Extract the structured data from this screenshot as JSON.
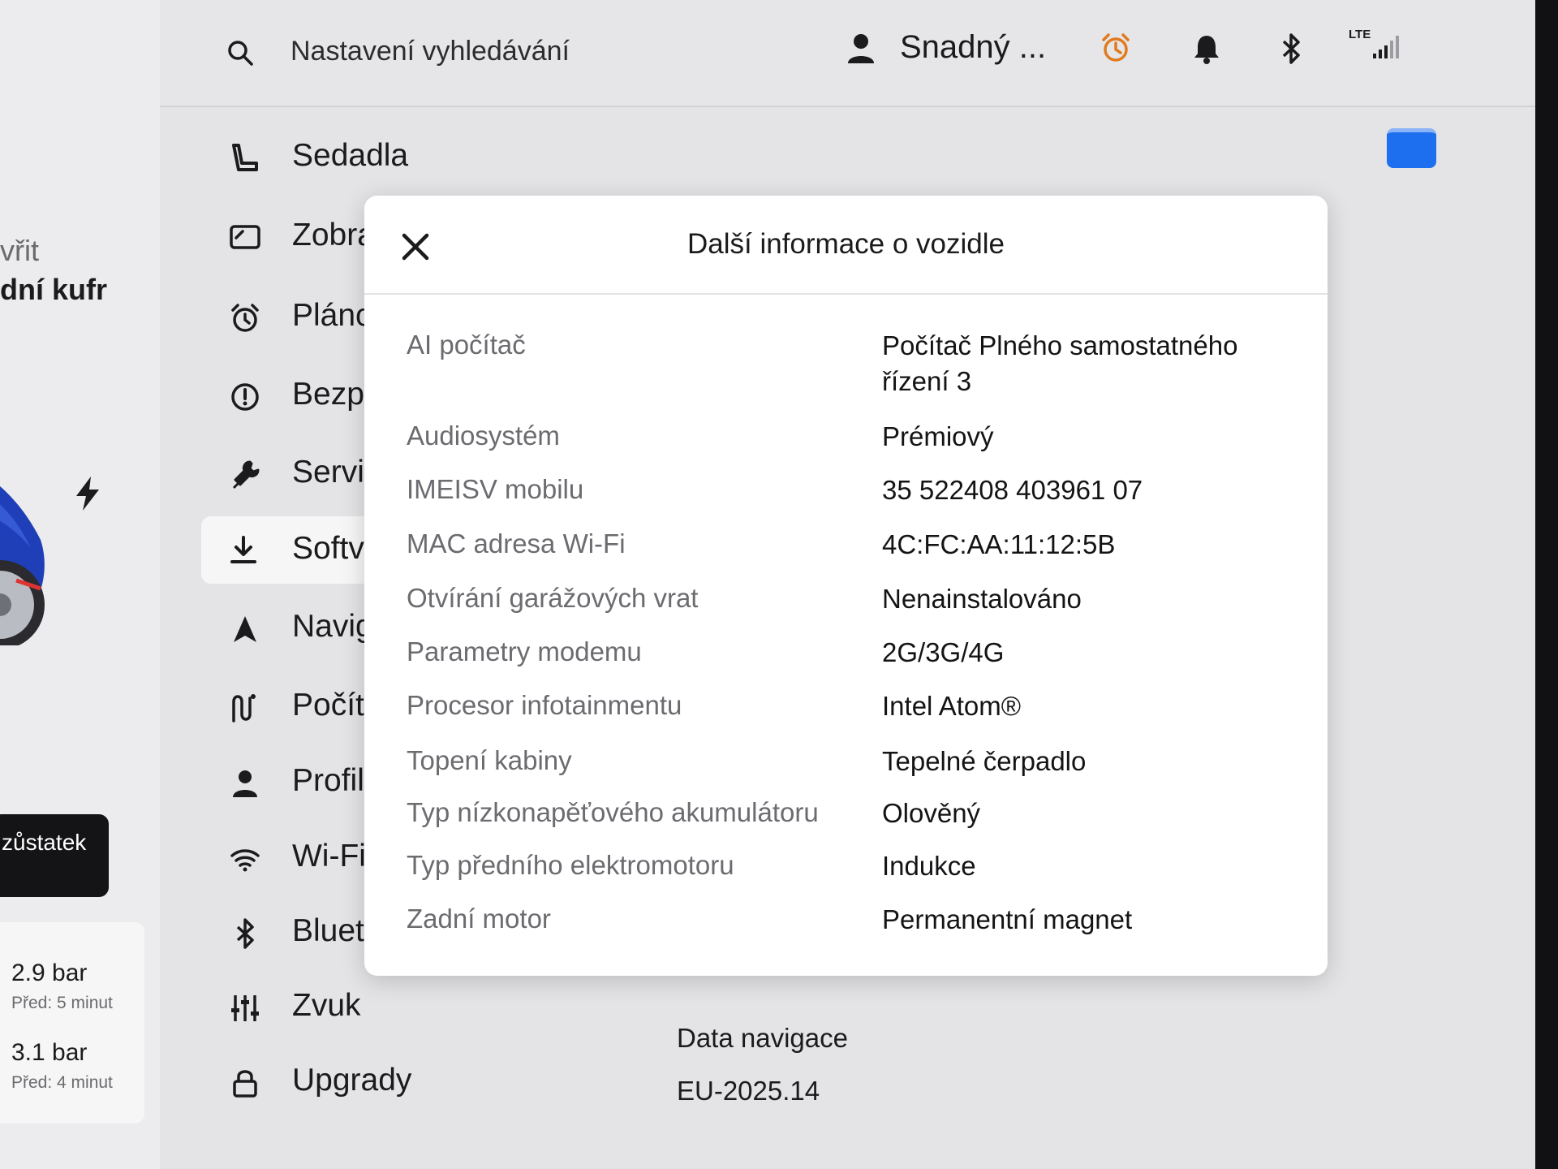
{
  "left_panel": {
    "open_text": "vřit",
    "trunk_text": "dní kufr",
    "remaining_label": "zůstatek",
    "tires": [
      {
        "value": "2.9 bar",
        "time": "Před: 5 minut"
      },
      {
        "value": "3.1 bar",
        "time": "Před: 4 minut"
      }
    ]
  },
  "topbar": {
    "search_placeholder": "Nastavení vyhledávání",
    "profile_name": "Snadný ...",
    "network_label": "LTE",
    "alarm_color": "#e07a1f"
  },
  "menu": [
    {
      "label": "Sedadla",
      "icon": "seat-icon",
      "active": false
    },
    {
      "label": "Zobra",
      "icon": "display-icon",
      "active": false
    },
    {
      "label": "Pláno",
      "icon": "alarm-clock-icon",
      "active": false
    },
    {
      "label": "Bezp",
      "icon": "exclamation-circle-icon",
      "active": false
    },
    {
      "label": "Servi",
      "icon": "wrench-icon",
      "active": false
    },
    {
      "label": "Softv",
      "icon": "download-icon",
      "active": true
    },
    {
      "label": "Navig",
      "icon": "navigation-arrow-icon",
      "active": false
    },
    {
      "label": "Počít",
      "icon": "route-icon",
      "active": false
    },
    {
      "label": "Profil",
      "icon": "person-icon",
      "active": false
    },
    {
      "label": "Wi-Fi",
      "icon": "wifi-icon",
      "active": false
    },
    {
      "label": "Bluet",
      "icon": "bluetooth-icon",
      "active": false
    },
    {
      "label": "Zvuk",
      "icon": "sliders-icon",
      "active": false
    },
    {
      "label": "Upgrady",
      "icon": "lock-icon",
      "active": false
    }
  ],
  "nav_data": {
    "title": "Data navigace",
    "value": "EU-2025.14"
  },
  "modal": {
    "title": "Další informace o vozidle",
    "rows": [
      {
        "label": "AI počítač",
        "value": "Počítač Plného samostatného řízení 3"
      },
      {
        "label": "Audiosystém",
        "value": "Prémiový"
      },
      {
        "label": "IMEISV mobilu",
        "value": "35 522408 403961 07"
      },
      {
        "label": "MAC adresa Wi-Fi",
        "value": "4C:FC:AA:11:12:5B"
      },
      {
        "label": "Otvírání garážových vrat",
        "value": "Nenainstalováno"
      },
      {
        "label": "Parametry modemu",
        "value": "2G/3G/4G"
      },
      {
        "label": "Procesor infotainmentu",
        "value": "Intel Atom®"
      },
      {
        "label": "Topení kabiny",
        "value": "Tepelné čerpadlo"
      },
      {
        "label": "Typ nízkonapěťového akumulátoru",
        "value": "Olověný"
      },
      {
        "label": "Typ předního elektromotoru",
        "value": "Indukce"
      },
      {
        "label": "Zadní motor",
        "value": "Permanentní magnet"
      }
    ]
  },
  "colors": {
    "accent_blue": "#1e6ff0",
    "car_blue": "#1f3fb8"
  }
}
